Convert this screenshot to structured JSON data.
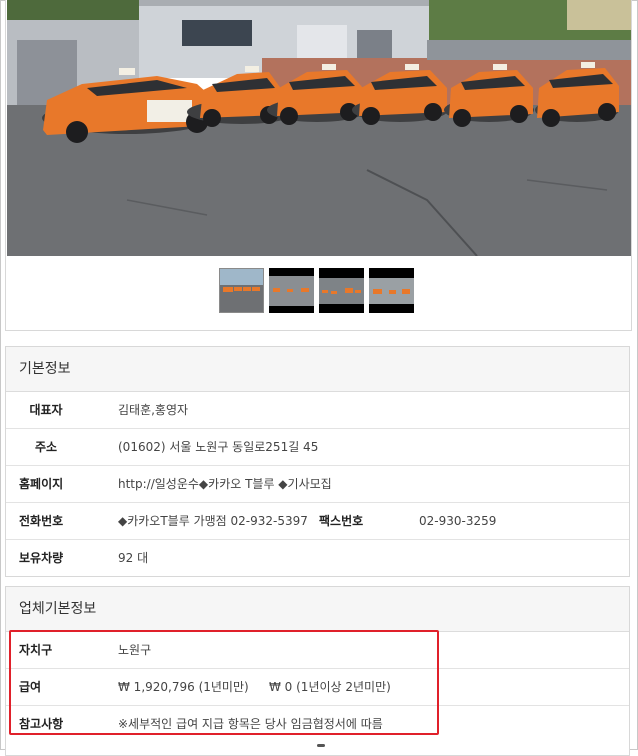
{
  "gallery": {
    "main_photo": "taxi-fleet-photo",
    "thumbnails": [
      "taxi-thumb-1",
      "taxi-thumb-2",
      "taxi-thumb-3",
      "taxi-thumb-4"
    ],
    "car_color": "#e8782a"
  },
  "basic_info": {
    "title": "기본정보",
    "rows": {
      "representative": {
        "label": "대표자",
        "value": "김태훈,홍영자"
      },
      "address": {
        "label": "주소",
        "value": "(01602) 서울 노원구 동일로251길 45"
      },
      "homepage": {
        "label": "홈페이지",
        "value": "http://일성운수◆카카오 T블루 ◆기사모집"
      },
      "phone": {
        "label": "전화번호",
        "value": "◆카카오T블루 가맹점 02-932-5397"
      },
      "fax": {
        "label": "팩스번호",
        "value": "02-930-3259"
      },
      "vehicles": {
        "label": "보유차량",
        "value": "92 대"
      }
    }
  },
  "company_info": {
    "title": "업체기본정보",
    "rows": {
      "district": {
        "label": "자치구",
        "value": "노원구"
      },
      "salary": {
        "label": "급여",
        "value1": "₩ 1,920,796 (1년미만)",
        "value2": "₩ 0 (1년이상 2년미만)"
      },
      "notes": {
        "label": "참고사항",
        "value": "※세부적인 급여 지급 항목은 당사 임금협정서에 따름"
      }
    }
  },
  "colors": {
    "highlight": "#e0202a",
    "section_header_bg": "#f6f6f6"
  }
}
